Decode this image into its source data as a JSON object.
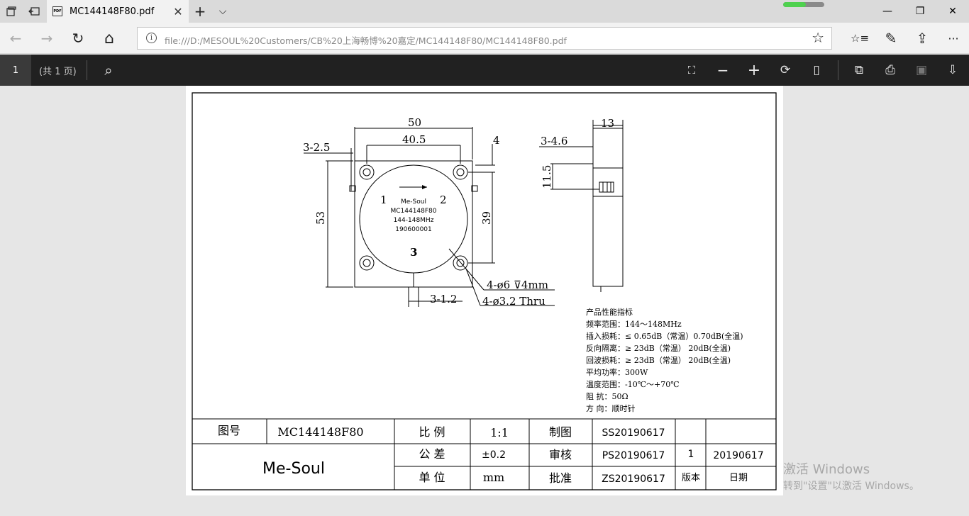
{
  "titlebar": {
    "tab_title": "MC144148F80.pdf",
    "tab_close": "✕",
    "new_tab": "+",
    "tab_list": "⌵",
    "pdf_badge": "PDF",
    "download_progress": 0.55,
    "minimize": "—",
    "maximize": "❐",
    "close": "✕"
  },
  "navbar": {
    "back": "←",
    "forward": "→",
    "refresh": "↻",
    "home": "⌂",
    "info": "i",
    "url": "file:///D:/MESOUL%20Customers/CB%20上海畅博%20嘉定/MC144148F80/MC144148F80.pdf",
    "favorite": "☆",
    "favorites_hub": "☆≡",
    "notes": "✎",
    "share": "⇪",
    "more": "···"
  },
  "pdfbar": {
    "page_number": "1",
    "page_total": "(共 1 页)",
    "search": "⌕",
    "fit": "⛶",
    "zoom_out": "−",
    "zoom_in": "+",
    "rotate": "⟳",
    "layout": "▯",
    "read_aloud": "⧉",
    "print": "⎙",
    "save": "▣",
    "save_as": "⇩"
  },
  "drawing": {
    "top_dims": {
      "width": "50",
      "inner": "40.5",
      "left_offset": "3-2.5",
      "right_small": "4",
      "height": "53",
      "hole_span": "39",
      "bottom_pin": "3-1.2",
      "hole1": "4-ø6 ⊽4mm",
      "hole2": "4-ø3.2 Thru",
      "port1": "1",
      "port2": "2",
      "port3": "3"
    },
    "label": {
      "brand": "Me-Soul",
      "model": "MC144148F80",
      "freq": "144-148MHz",
      "serial": "190600001"
    },
    "side_dims": {
      "thickness": "13",
      "pin_offset": "3-4.6",
      "pin_height": "11.5"
    },
    "specs": [
      "产品性能指标",
      "频率范围：144～148MHz",
      "插入损耗：≤ 0.65dB（常温）0.70dB(全温)",
      "反向隔离：≥ 23dB（常温）  20dB(全温)",
      "回波损耗：≥ 23dB（常温）  20dB(全温)",
      "平均功率：300W",
      "温度范围：-10℃～+70℃",
      "阻      抗：50Ω",
      "方      向：顺时针"
    ]
  },
  "title_block": {
    "drawing_no_label": "图号",
    "drawing_no": "MC144148F80",
    "scale_label": "比 例",
    "scale": "1:1",
    "drawn_label": "制图",
    "drawn": "SS20190617",
    "company": "Me-Soul",
    "tolerance_label": "公 差",
    "tolerance": "±0.2",
    "check_label": "审核",
    "check": "PS20190617",
    "version": "1",
    "date": "20190617",
    "unit_label": "单 位",
    "unit": "mm",
    "approve_label": "批准",
    "approve": "ZS20190617",
    "version_label": "版本",
    "date_label": "日期"
  },
  "watermark": {
    "line1": "激活 Windows",
    "line2": "转到\"设置\"以激活 Windows。"
  }
}
